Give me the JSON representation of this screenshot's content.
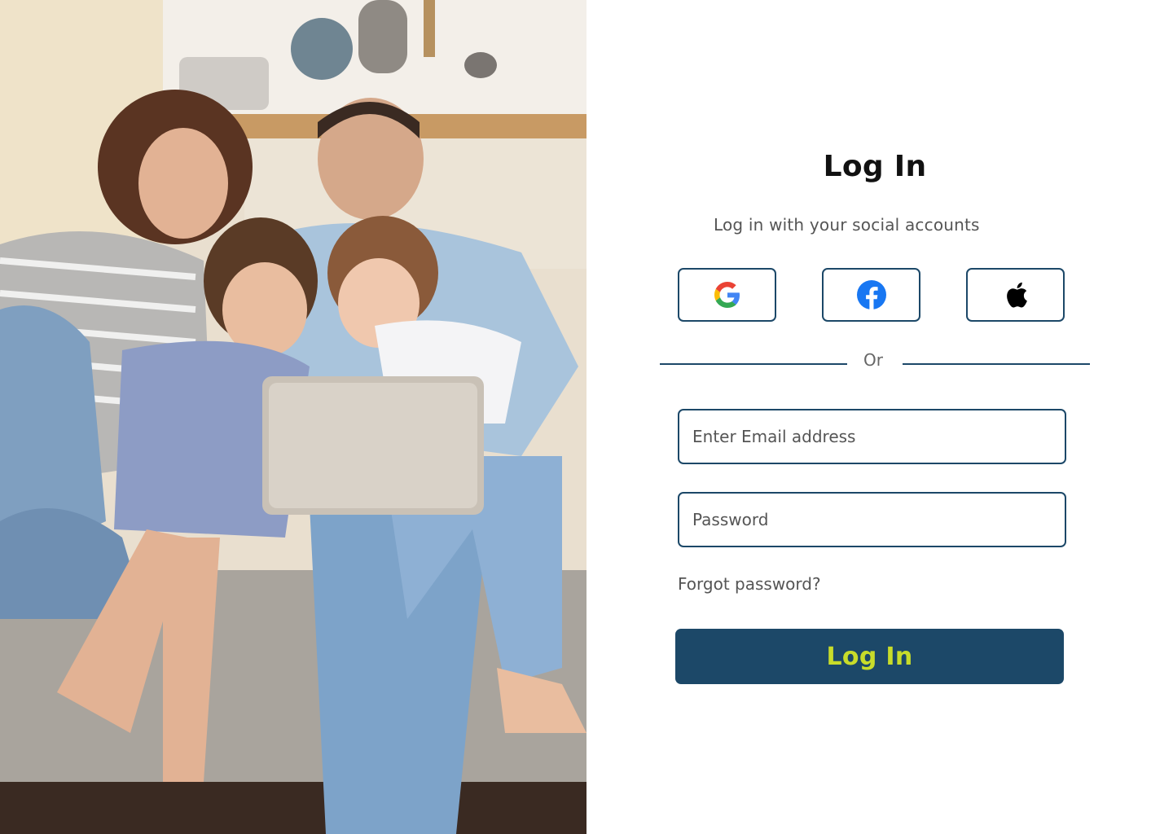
{
  "hero": {
    "image": "family-on-couch-with-laptop-photo"
  },
  "login": {
    "title": "Log In",
    "subtitle": "Log in with your social accounts",
    "social_buttons": [
      {
        "provider": "google",
        "icon": "google-icon"
      },
      {
        "provider": "facebook",
        "icon": "facebook-icon",
        "color": "#1877F2"
      },
      {
        "provider": "apple",
        "icon": "apple-icon",
        "color": "#000000"
      }
    ],
    "divider_text": "Or",
    "email": {
      "placeholder": "Enter Email address",
      "value": ""
    },
    "password": {
      "placeholder": "Password",
      "value": ""
    },
    "forgot_label": "Forgot password?",
    "submit_label": "Log In"
  },
  "colors": {
    "primary": "#1C4868",
    "accent": "#C8DC2A",
    "border": "#1C4868",
    "muted_text": "#555555"
  }
}
